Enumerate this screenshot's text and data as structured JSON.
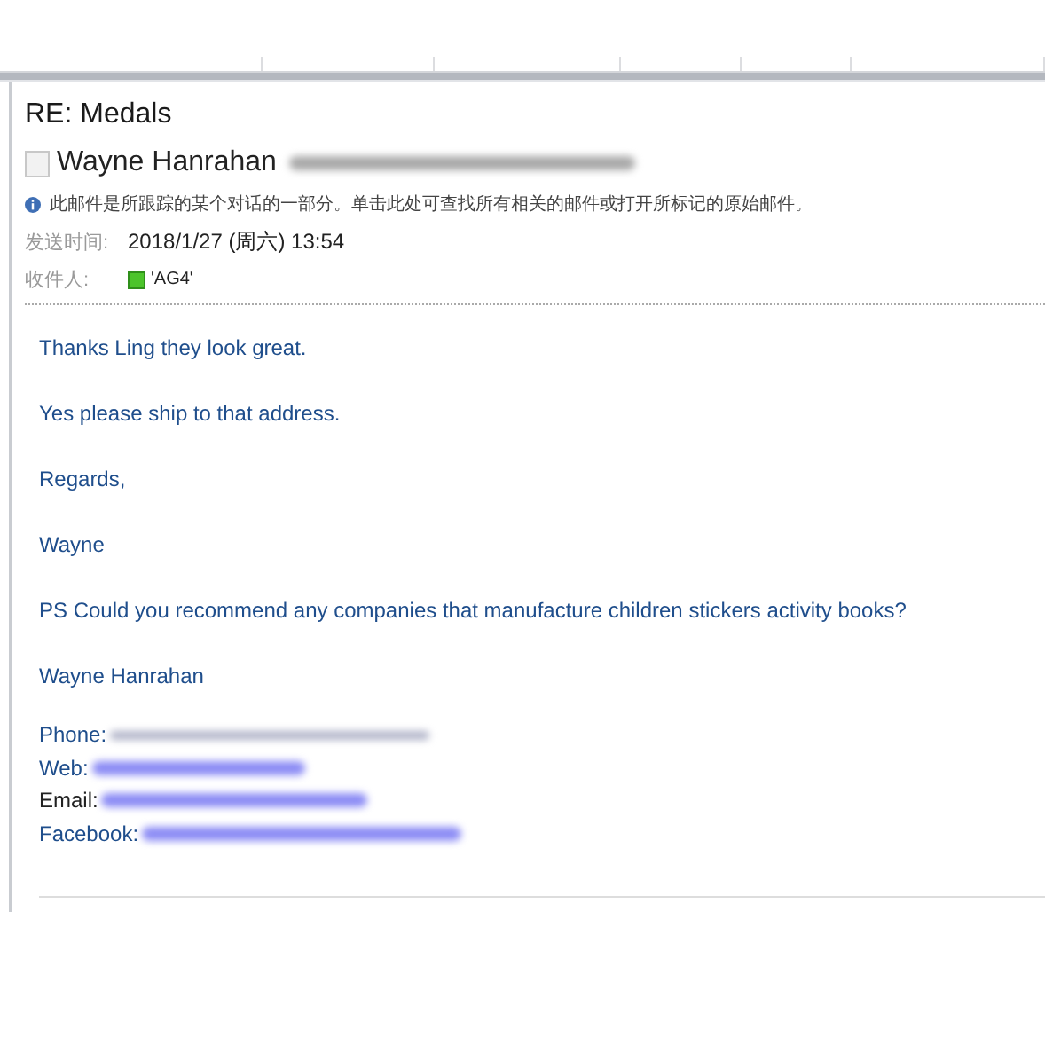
{
  "message": {
    "subject": "RE: Medals",
    "sender": "Wayne Hanrahan",
    "info_bar": "此邮件是所跟踪的某个对话的一部分。单击此处可查找所有相关的邮件或打开所标记的原始邮件。",
    "fields": [
      {
        "label": "发送时间:",
        "value": "2018/1/27 (周六) 13:54",
        "kind": "text"
      },
      {
        "label": "收件人:",
        "value": "'AG4'",
        "kind": "recipient"
      }
    ]
  },
  "body": {
    "paragraphs": [
      "Thanks Ling they look great.",
      "Yes please ship to that address.",
      "Regards,",
      "Wayne",
      "PS Could you recommend any companies that manufacture children stickers activity books?",
      "Wayne Hanrahan"
    ],
    "contacts": [
      {
        "label": "Phone:",
        "kind": "plain"
      },
      {
        "label": "Web:",
        "kind": "link"
      },
      {
        "label": "Email:",
        "kind": "link"
      },
      {
        "label": "Facebook:",
        "kind": "link"
      }
    ]
  }
}
